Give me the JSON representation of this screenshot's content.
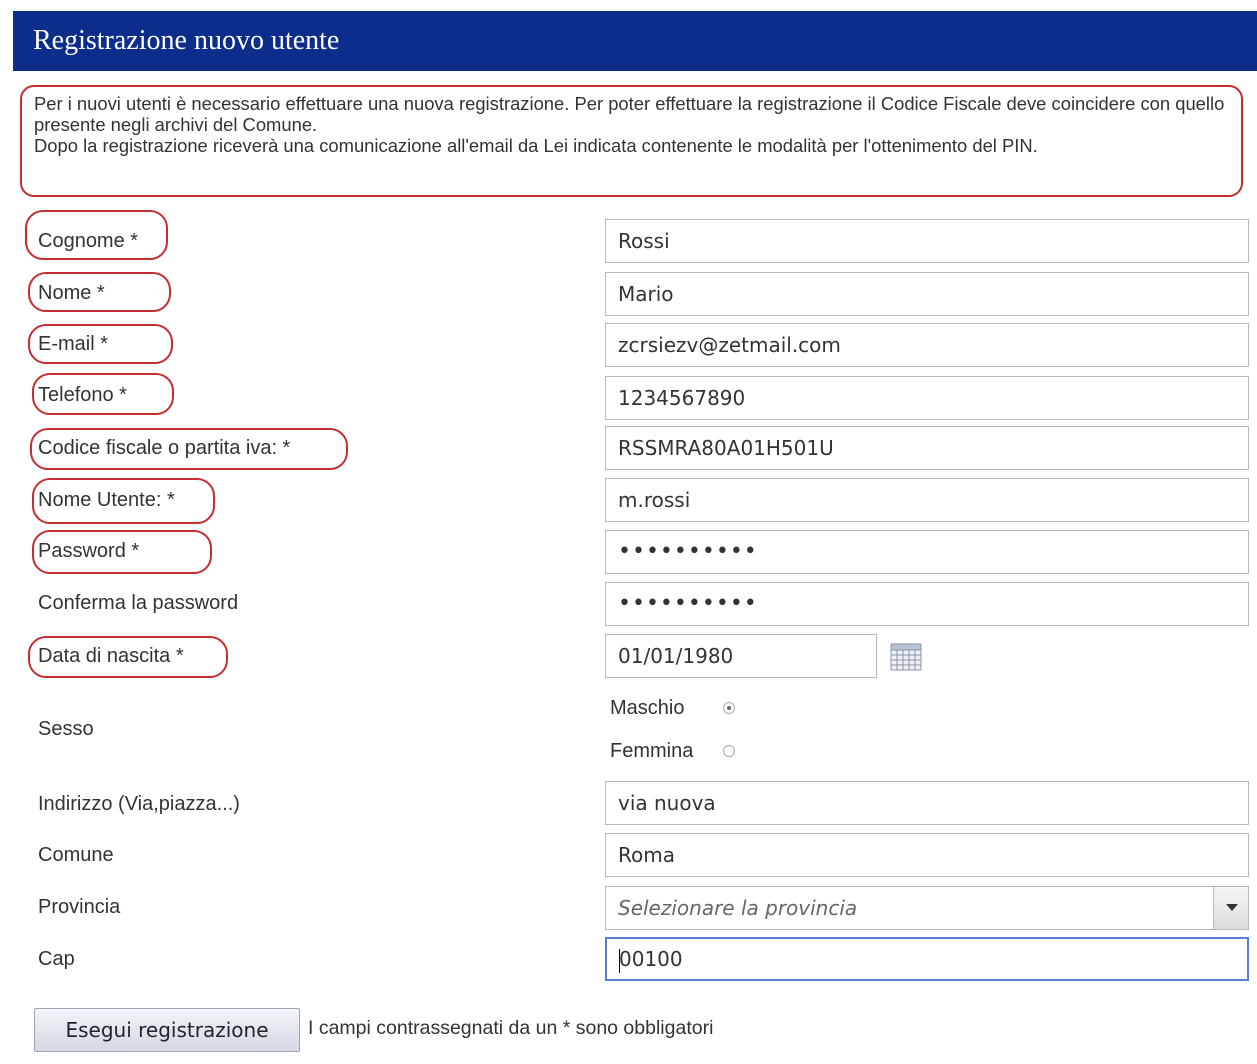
{
  "header": {
    "title": "Registrazione nuovo utente"
  },
  "intro": {
    "paragraph1": "Per i nuovi utenti è necessario effettuare una nuova registrazione. Per poter effettuare la registrazione il Codice Fiscale deve coincidere con quello presente negli archivi del Comune.",
    "paragraph2": "Dopo la registrazione riceverà una comunicazione all'email da Lei indicata contenente le modalità per l'ottenimento del PIN."
  },
  "form": {
    "cognome": {
      "label": "Cognome *",
      "value": "Rossi"
    },
    "nome": {
      "label": "Nome *",
      "value": "Mario"
    },
    "email": {
      "label": "E-mail *",
      "value": "zcrsiezv@zetmail.com"
    },
    "telefono": {
      "label": "Telefono *",
      "value": "1234567890"
    },
    "codice_fiscale": {
      "label": "Codice fiscale o partita iva: *",
      "value": "RSSMRA80A01H501U"
    },
    "nome_utente": {
      "label": "Nome Utente: *",
      "value": "m.rossi"
    },
    "password": {
      "label": "Password *",
      "value": "••••••••••"
    },
    "conferma_password": {
      "label": "Conferma la password",
      "value": "••••••••••"
    },
    "data_nascita": {
      "label": "Data di nascita *",
      "value": "01/01/1980"
    },
    "sesso": {
      "label": "Sesso",
      "options": [
        {
          "label": "Maschio",
          "selected": true
        },
        {
          "label": "Femmina",
          "selected": false
        }
      ]
    },
    "indirizzo": {
      "label": "Indirizzo (Via,piazza...)",
      "value": "via nuova"
    },
    "comune": {
      "label": "Comune",
      "value": "Roma"
    },
    "provincia": {
      "label": "Provincia",
      "placeholder": "Selezionare la provincia"
    },
    "cap": {
      "label": "Cap",
      "value": "00100"
    }
  },
  "actions": {
    "submit_label": "Esegui registrazione",
    "required_note": "I campi contrassegnati da un * sono obbligatori"
  },
  "colors": {
    "header_bg": "#0c2d8c",
    "highlight_red": "#c42e2e",
    "focus_blue": "#5a7fd0"
  }
}
